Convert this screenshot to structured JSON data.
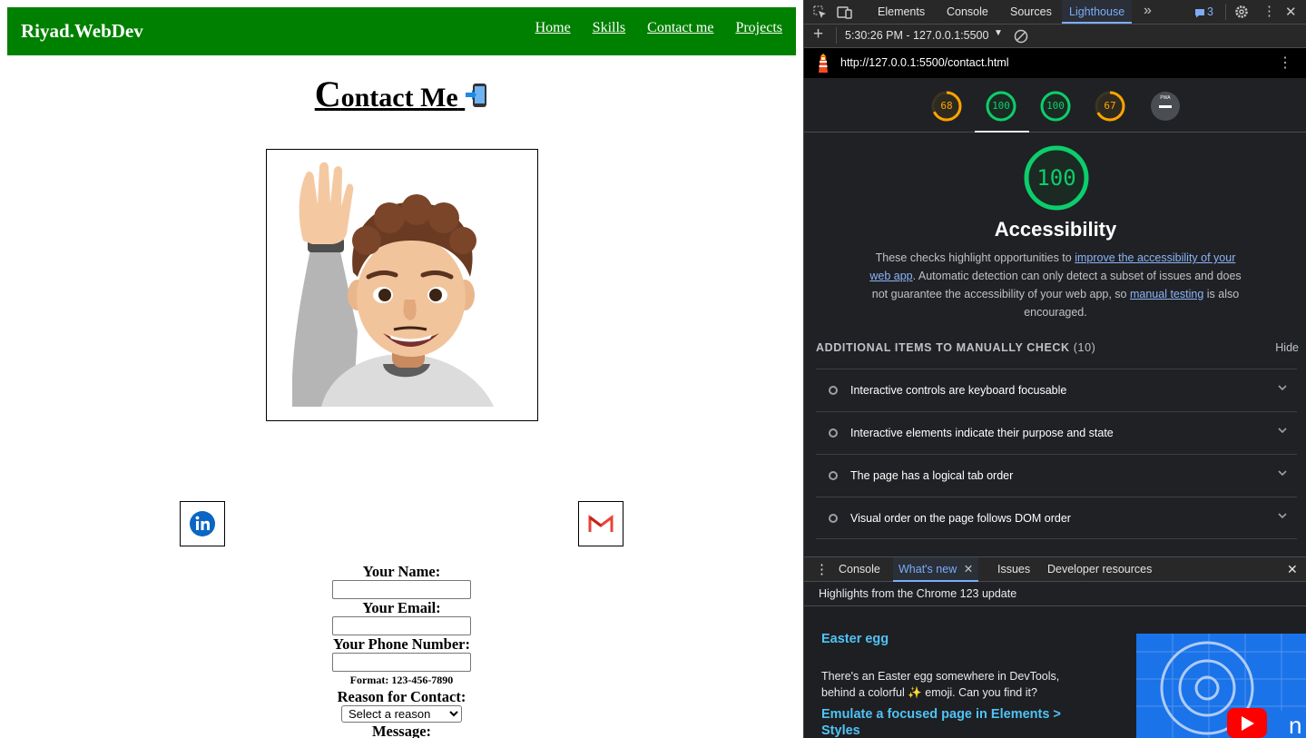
{
  "site": {
    "brand": "Riyad.WebDev",
    "nav": [
      "Home",
      "Skills",
      "Contact me",
      "Projects"
    ],
    "title_first": "C",
    "title_rest": "ontact Me",
    "form": {
      "name_label": "Your Name:",
      "email_label": "Your Email:",
      "phone_label": "Your Phone Number:",
      "phone_hint": "Format: 123-456-7890",
      "reason_label": "Reason for Contact:",
      "reason_selected": "Select a reason",
      "message_label": "Message:"
    },
    "icons": {
      "phone": "mobile-phone-arrow-icon",
      "linkedin": "linkedin-icon",
      "gmail": "gmail-icon",
      "avatar": "memoji-waving-avatar"
    },
    "colors": {
      "navbar": "#008000",
      "nav_text": "#ffffff"
    }
  },
  "devtools": {
    "tabs": [
      "Elements",
      "Console",
      "Sources",
      "Lighthouse"
    ],
    "active_tab": "Lighthouse",
    "issues_count": "3",
    "report_selector": "5:30:26 PM - 127.0.0.1:5500",
    "report_url": "http://127.0.0.1:5500/contact.html",
    "scores": [
      {
        "value": "68",
        "color": "#ffa400"
      },
      {
        "value": "100",
        "color": "#0cce6b"
      },
      {
        "value": "100",
        "color": "#0cce6b"
      },
      {
        "value": "67",
        "color": "#ffa400"
      }
    ],
    "pwa_label": "PWA",
    "category": {
      "score": "100",
      "title": "Accessibility",
      "desc_before": "These checks highlight opportunities to ",
      "desc_link1": "improve the accessibility of your web app",
      "desc_middle": ". Automatic detection can only detect a subset of issues and does not guarantee the accessibility of your web app, so ",
      "desc_link2": "manual testing",
      "desc_after": " is also encouraged."
    },
    "manual": {
      "heading": "ADDITIONAL ITEMS TO MANUALLY CHECK",
      "count": "(10)",
      "hide": "Hide",
      "items": [
        "Interactive controls are keyboard focusable",
        "Interactive elements indicate their purpose and state",
        "The page has a logical tab order",
        "Visual order on the page follows DOM order"
      ]
    },
    "drawer": {
      "tabs": [
        "Console",
        "What's new",
        "Issues",
        "Developer resources"
      ],
      "active": "What's new",
      "header": "Highlights from the Chrome 123 update",
      "items": [
        {
          "title": "Easter egg",
          "body_before": "There's an Easter egg somewhere in DevTools, behind a colorful ",
          "body_after": " emoji. Can you find it?"
        },
        {
          "title": "Emulate a focused page in Elements > Styles"
        }
      ]
    }
  }
}
